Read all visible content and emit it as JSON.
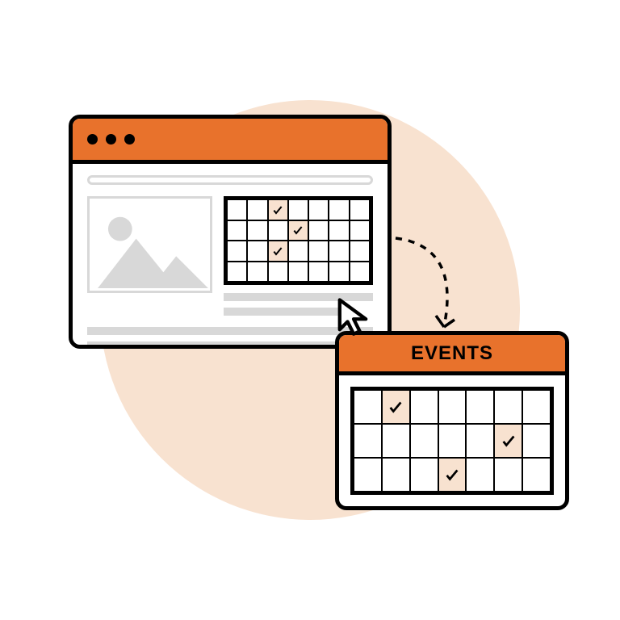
{
  "events_panel": {
    "title": "EVENTS"
  },
  "colors": {
    "accent": "#e8722c",
    "tint": "#f8e2d0"
  },
  "browser_calendar": {
    "rows": 4,
    "cols": 7,
    "checked_cells": [
      2,
      10,
      16
    ]
  },
  "events_calendar": {
    "rows": 3,
    "cols": 7,
    "checked_cells": [
      1,
      12,
      17
    ]
  }
}
